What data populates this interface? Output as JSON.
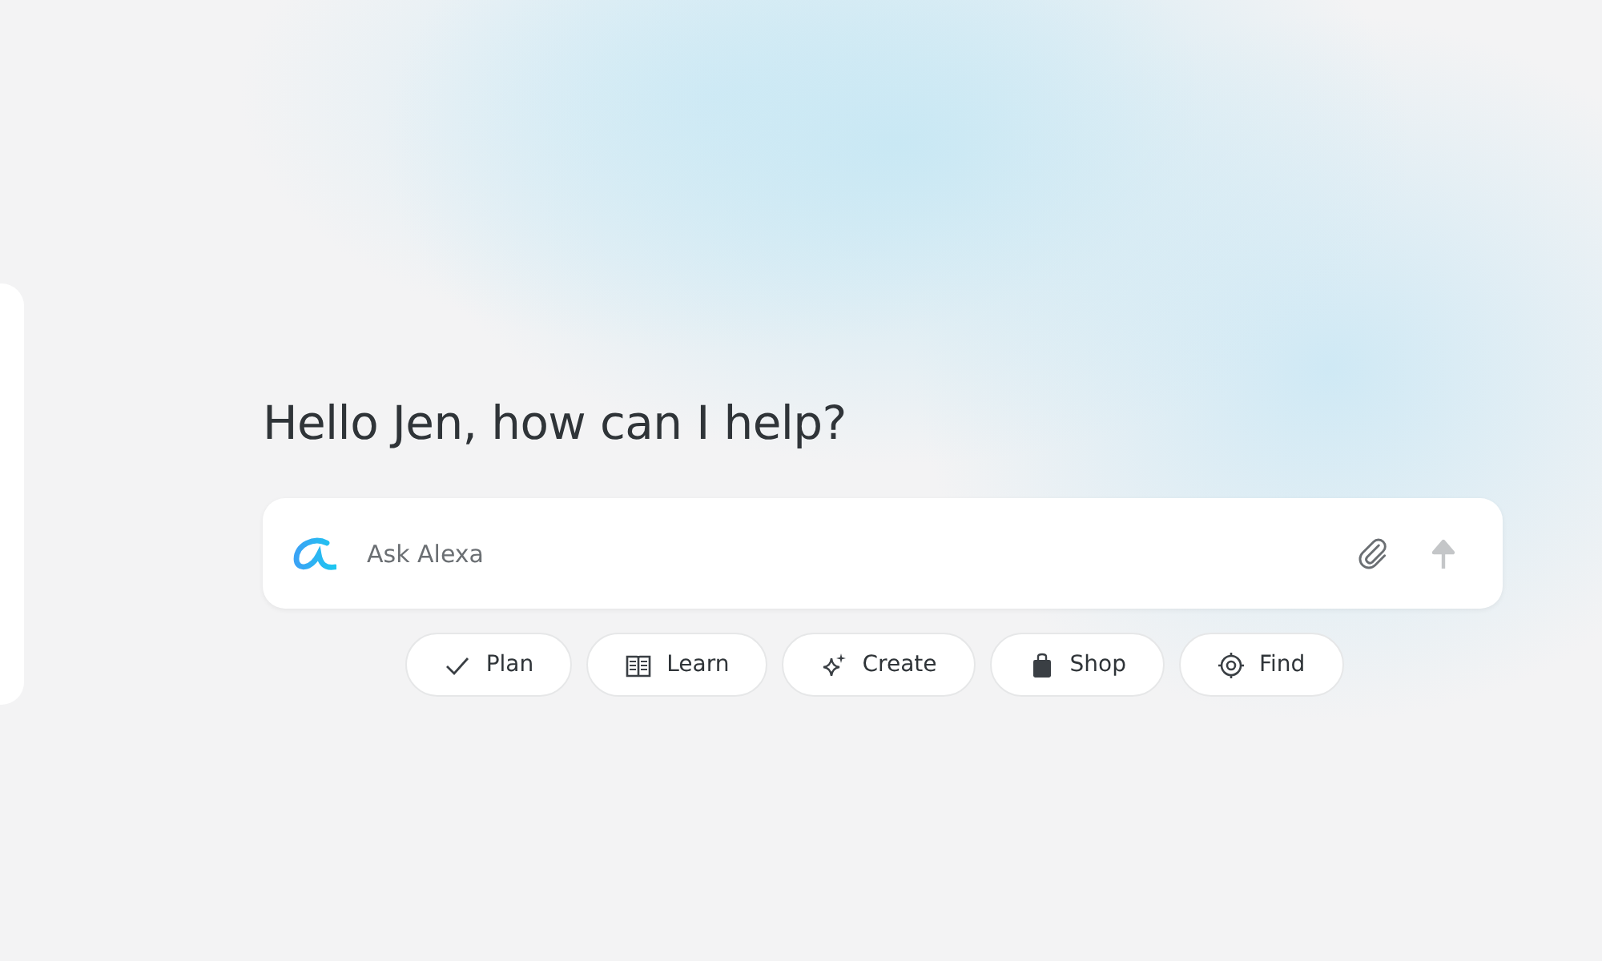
{
  "greeting": "Hello Jen, how can I help?",
  "prompt": {
    "placeholder": "Ask Alexa",
    "send_disabled": true
  },
  "chips": [
    {
      "kind": "check",
      "label": "Plan"
    },
    {
      "kind": "book",
      "label": "Learn"
    },
    {
      "kind": "sparkle",
      "label": "Create"
    },
    {
      "kind": "bag",
      "label": "Shop"
    },
    {
      "kind": "target",
      "label": "Find"
    }
  ]
}
